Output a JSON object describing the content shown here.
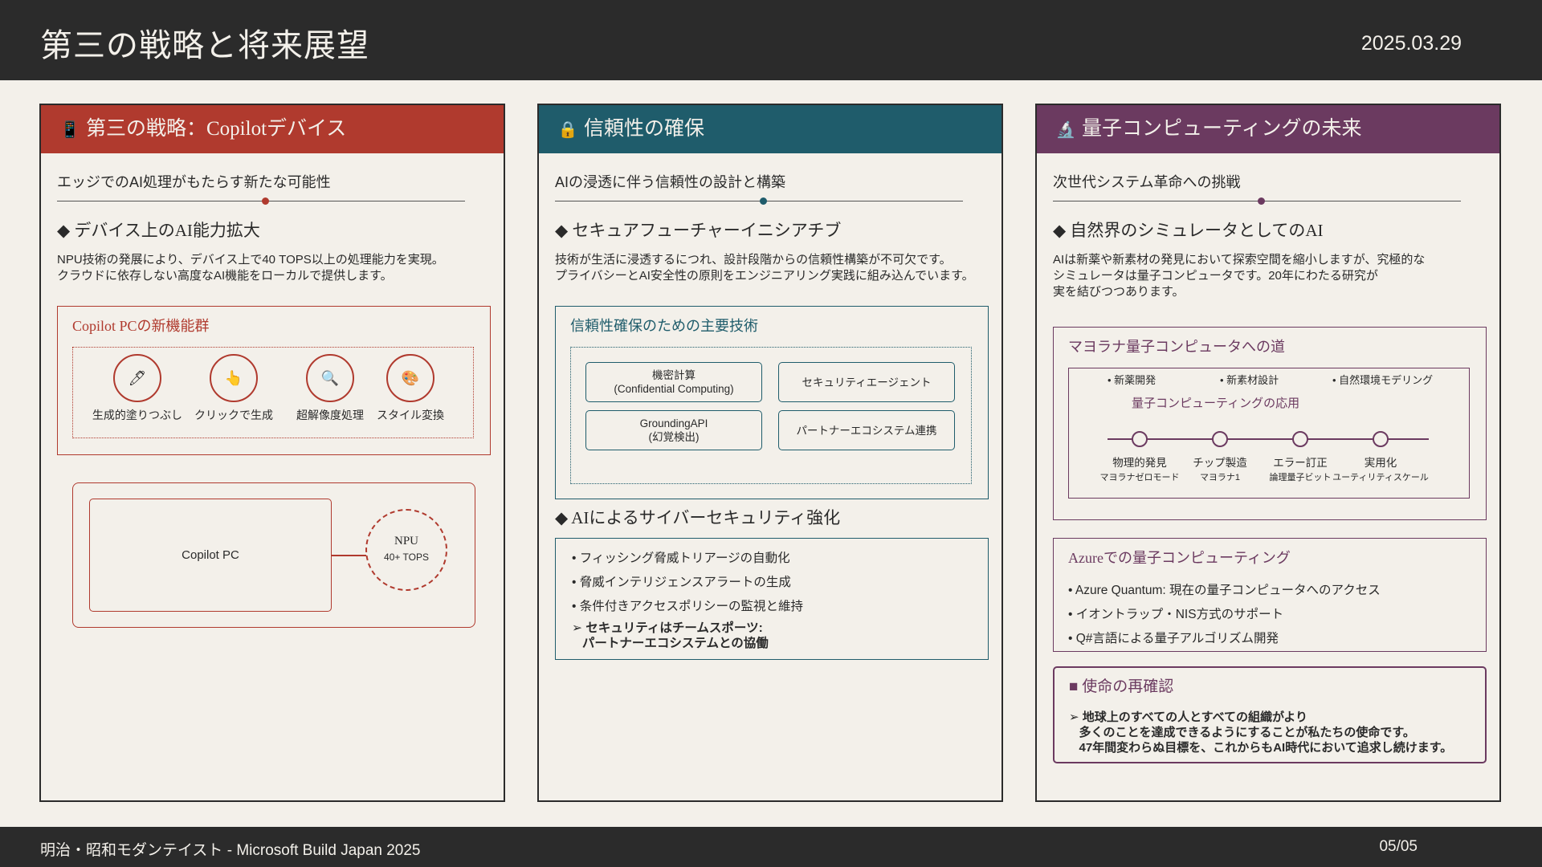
{
  "header": {
    "title": "第三の戦略と将来展望",
    "date": "2025.03.29"
  },
  "footer": {
    "text": "明治・昭和モダンテイスト - Microsoft Build Japan 2025",
    "page": "05/05"
  },
  "colors": {
    "red": "#b03a2e",
    "teal": "#1f5c6b",
    "purple": "#6b3a60",
    "dark": "#2b2b2b",
    "bg": "#f3f0ea"
  },
  "panel1": {
    "icon": "📱",
    "title": "第三の戦略：Copilotデバイス",
    "subtitle": "エッジでのAI処理がもたらす新たな可能性",
    "heading": "◆ デバイス上のAI能力拡大",
    "body": "NPU技術の発展により、デバイス上で40 TOPS以上の処理能力を実現。\nクラウドに依存しない高度なAI機能をローカルで提供します。",
    "features_title": "Copilot PCの新機能群",
    "features": [
      {
        "icon": "🖊",
        "label": "生成的塗りつぶし"
      },
      {
        "icon": "👆",
        "label": "クリックで生成"
      },
      {
        "icon": "🔍",
        "label": "超解像度処理"
      },
      {
        "icon": "🎨",
        "label": "スタイル変換"
      }
    ],
    "diagram": {
      "pc": "Copilot PC",
      "npu": "NPU",
      "tops": "40+ TOPS"
    }
  },
  "panel2": {
    "icon": "🔒",
    "title": "信頼性の確保",
    "subtitle": "AIの浸透に伴う信頼性の設計と構築",
    "heading": "◆ セキュアフューチャーイニシアチブ",
    "body": "技術が生活に浸透するにつれ、設計段階からの信頼性構築が不可欠です。\nプライバシーとAI安全性の原則をエンジニアリング実践に組み込んでいます。",
    "tech_title": "信頼性確保のための主要技術",
    "techs": [
      "機密計算\n(Confidential Computing)",
      "セキュリティエージェント",
      "GroundingAPI\n(幻覚検出)",
      "パートナーエコシステム連携"
    ],
    "heading2": "◆ AIによるサイバーセキュリティ強化",
    "items": [
      "• フィッシング脅威トリアージの自動化",
      "• 脅威インテリジェンスアラートの生成",
      "• 条件付きアクセスポリシーの監視と維持"
    ],
    "emphasis": "➢ セキュリティはチームスポーツ:\n   パートナーエコシステムとの協働"
  },
  "panel3": {
    "icon": "🔬",
    "title": "量子コンピューティングの未来",
    "subtitle": "次世代システム革命への挑戦",
    "heading": "◆ 自然界のシミュレータとしてのAI",
    "body": "AIは新薬や新素材の発見において探索空間を縮小しますが、究極的な\nシミュレータは量子コンピュータです。20年にわたる研究が\n実を結びつつあります。",
    "road_title": "マヨラナ量子コンピュータへの道",
    "apps": [
      "• 新薬開発",
      "• 新素材設計",
      "• 自然環境モデリング"
    ],
    "apps_title": "量子コンピューティングの応用",
    "steps": [
      {
        "label": "物理的発見",
        "sub": "マヨラナゼロモード"
      },
      {
        "label": "チップ製造",
        "sub": "マヨラナ1"
      },
      {
        "label": "エラー訂正",
        "sub": "論理量子ビット"
      },
      {
        "label": "実用化",
        "sub": "ユーティリティスケール"
      }
    ],
    "azure_title": "Azureでの量子コンピューティング",
    "azure_items": [
      "• Azure Quantum: 現在の量子コンピュータへのアクセス",
      "• イオントラップ・NIS方式のサポート",
      "• Q#言語による量子アルゴリズム開発"
    ],
    "mission_title": "■ 使命の再確認",
    "mission": "➢ 地球上のすべての人とすべての組織がより\n   多くのことを達成できるようにすることが私たちの使命です。\n   47年間変わらぬ目標を、これからもAI時代において追求し続けます。"
  }
}
